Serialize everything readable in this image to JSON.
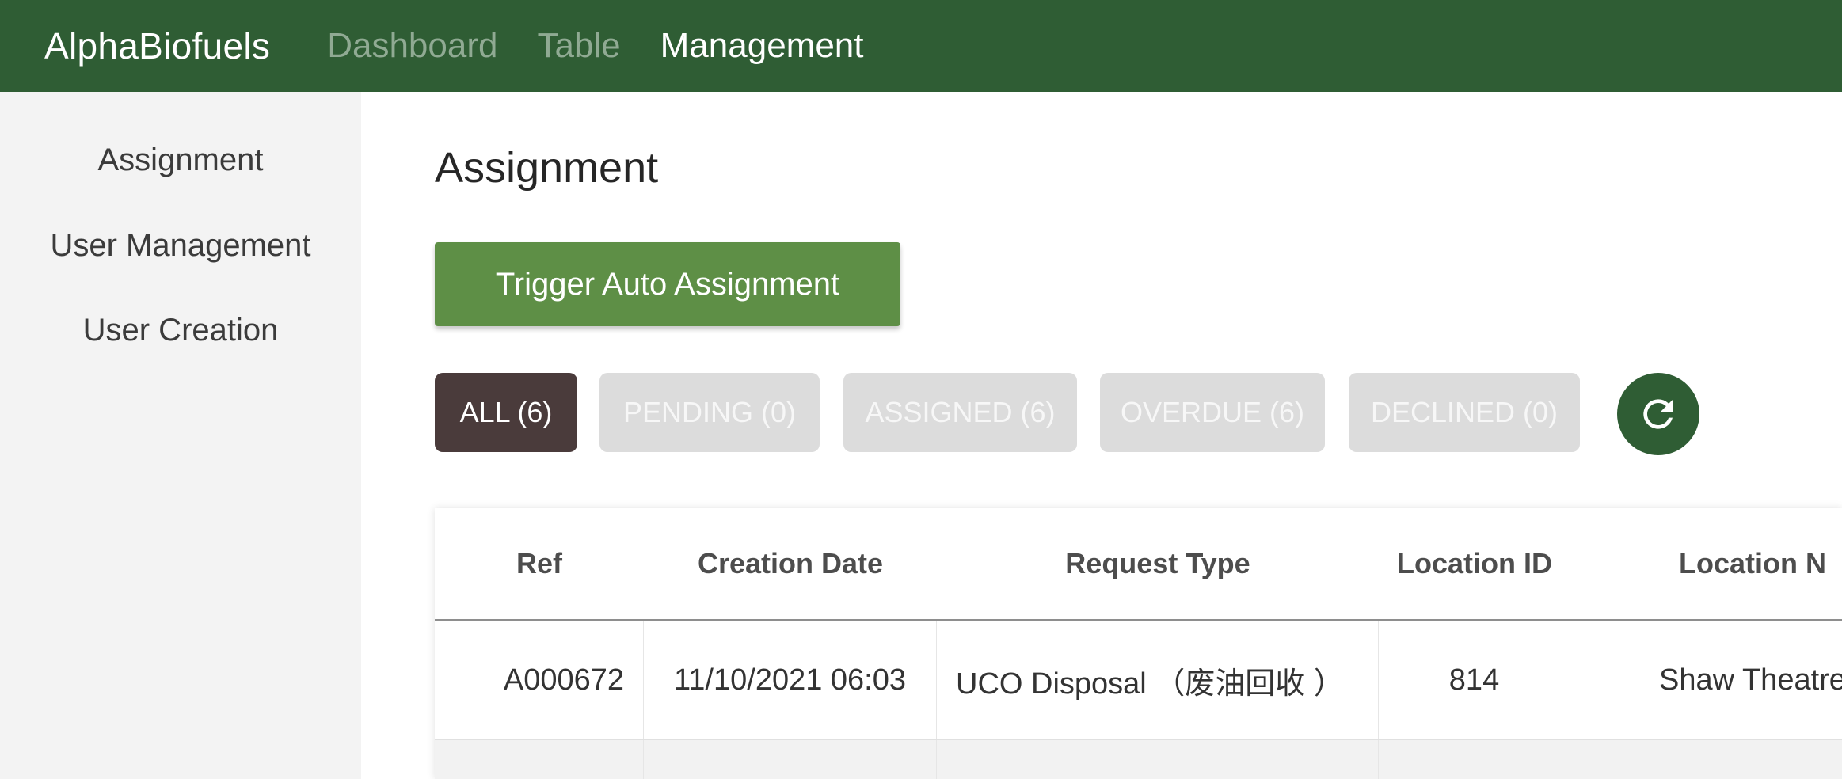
{
  "header": {
    "brand": "AlphaBiofuels",
    "nav": [
      {
        "label": "Dashboard",
        "active": false
      },
      {
        "label": "Table",
        "active": false
      },
      {
        "label": "Management",
        "active": true
      }
    ]
  },
  "sidebar": {
    "items": [
      {
        "label": "Assignment"
      },
      {
        "label": "User Management"
      },
      {
        "label": "User Creation"
      }
    ]
  },
  "main": {
    "title": "Assignment",
    "trigger_button": "Trigger Auto Assignment",
    "filters": [
      {
        "label": "ALL (6)",
        "active": true
      },
      {
        "label": "PENDING (0)",
        "active": false
      },
      {
        "label": "ASSIGNED (6)",
        "active": false
      },
      {
        "label": "OVERDUE (6)",
        "active": false
      },
      {
        "label": "DECLINED (0)",
        "active": false
      }
    ],
    "refresh_icon": "refresh-icon",
    "table": {
      "headers": [
        "Ref",
        "Creation Date",
        "Request Type",
        "Location ID",
        "Location N"
      ],
      "rows": [
        [
          "A000672",
          "11/10/2021 06:03",
          "UCO Disposal （废油回收 ）",
          "814",
          "Shaw Theatre"
        ]
      ]
    }
  },
  "colors": {
    "header_bg": "#2f5d34",
    "primary_button": "#5e8f46",
    "active_filter": "#4a3b3b",
    "inactive_filter": "#dcdcdc"
  }
}
